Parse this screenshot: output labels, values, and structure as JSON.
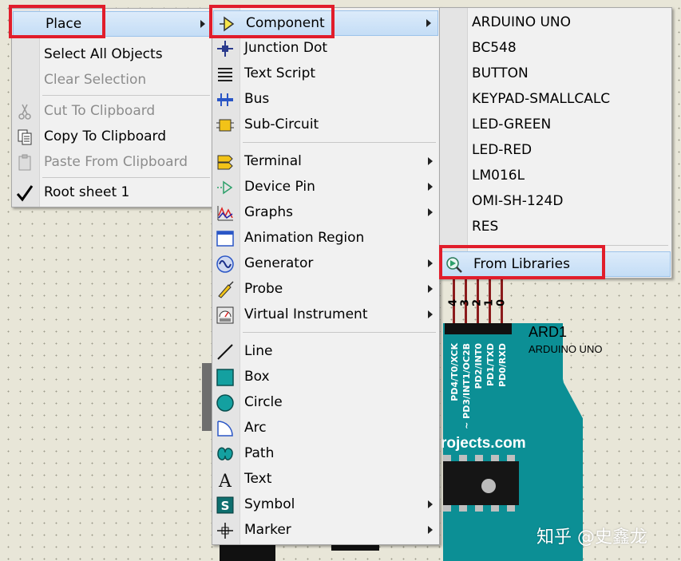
{
  "main_menu": {
    "items": [
      {
        "label": "Place",
        "icon": "",
        "disabled": false,
        "submenu": true
      },
      {
        "label": "Select All Objects",
        "icon": "",
        "disabled": false
      },
      {
        "label": "Clear Selection",
        "icon": "",
        "disabled": true
      },
      {
        "label": "Cut To Clipboard",
        "icon": "scissors-icon",
        "disabled": true
      },
      {
        "label": "Copy To Clipboard",
        "icon": "copy-icon",
        "disabled": false
      },
      {
        "label": "Paste From Clipboard",
        "icon": "paste-icon",
        "disabled": true
      },
      {
        "label": "Root sheet 1",
        "icon": "checkmark-icon",
        "disabled": false
      }
    ]
  },
  "place_menu": {
    "items": [
      {
        "label": "Component",
        "icon": "component-icon",
        "submenu": true
      },
      {
        "label": "Junction Dot",
        "icon": "junction-dot-icon"
      },
      {
        "label": "Text Script",
        "icon": "text-script-icon"
      },
      {
        "label": "Bus",
        "icon": "bus-icon"
      },
      {
        "label": "Sub-Circuit",
        "icon": "sub-circuit-icon"
      },
      {
        "label": "Terminal",
        "icon": "terminal-icon",
        "submenu": true
      },
      {
        "label": "Device Pin",
        "icon": "device-pin-icon",
        "submenu": true
      },
      {
        "label": "Graphs",
        "icon": "graphs-icon",
        "submenu": true
      },
      {
        "label": "Animation Region",
        "icon": "animation-region-icon"
      },
      {
        "label": "Generator",
        "icon": "generator-icon",
        "submenu": true
      },
      {
        "label": "Probe",
        "icon": "probe-icon",
        "submenu": true
      },
      {
        "label": "Virtual Instrument",
        "icon": "virtual-instrument-icon",
        "submenu": true
      },
      {
        "label": "Line",
        "icon": "line-icon"
      },
      {
        "label": "Box",
        "icon": "box-icon"
      },
      {
        "label": "Circle",
        "icon": "circle-icon"
      },
      {
        "label": "Arc",
        "icon": "arc-icon"
      },
      {
        "label": "Path",
        "icon": "path-icon"
      },
      {
        "label": "Text",
        "icon": "text-icon"
      },
      {
        "label": "Symbol",
        "icon": "symbol-icon",
        "submenu": true
      },
      {
        "label": "Marker",
        "icon": "marker-icon",
        "submenu": true
      }
    ]
  },
  "component_menu": {
    "items": [
      {
        "label": "ARDUINO UNO"
      },
      {
        "label": "BC548"
      },
      {
        "label": "BUTTON"
      },
      {
        "label": "KEYPAD-SMALLCALC"
      },
      {
        "label": "LED-GREEN"
      },
      {
        "label": "LED-RED"
      },
      {
        "label": "LM016L"
      },
      {
        "label": "OMI-SH-124D"
      },
      {
        "label": "RES"
      },
      {
        "label": "From Libraries",
        "icon": "library-search-icon"
      }
    ]
  },
  "schematic": {
    "part_ref": "ARD1",
    "part_name": "ARDUINO UNO",
    "pin_numbers": [
      "4",
      "3",
      "2",
      "1",
      "0"
    ],
    "pin_labels": [
      "PD4/T0/XCK",
      "~ PD3/INT1/OC2B",
      "PD2/INT0",
      "PD1/TXD",
      "PD0/RXD"
    ],
    "board_text": "rojects.com",
    "watermark": "知乎 @史鑫龙"
  },
  "colors": {
    "highlight_box": "#e11d2b",
    "board": "#0c8f95",
    "menu_bg": "#f1f1f1"
  }
}
